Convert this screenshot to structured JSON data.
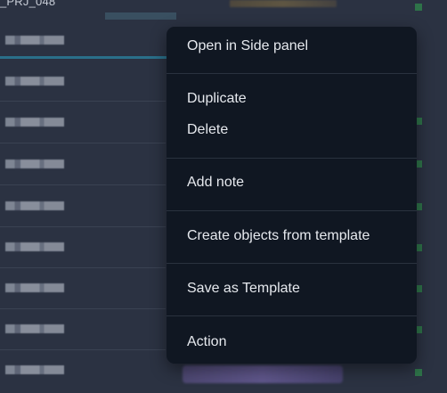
{
  "background": {
    "top_label": "_PRJ_048"
  },
  "context_menu": {
    "items": [
      {
        "label": "Open in Side panel"
      },
      {
        "label": "Duplicate"
      },
      {
        "label": "Delete"
      },
      {
        "label": "Add note"
      },
      {
        "label": "Create objects from template"
      },
      {
        "label": "Save as Template"
      },
      {
        "label": "Action"
      }
    ]
  },
  "colors": {
    "menu_background": "#101722",
    "menu_text": "#e6e9ee",
    "separator": "#2a323f",
    "page_background": "#2b3242",
    "selection_accent": "#2a6f8a",
    "status_tag": "#2f7a4a"
  }
}
